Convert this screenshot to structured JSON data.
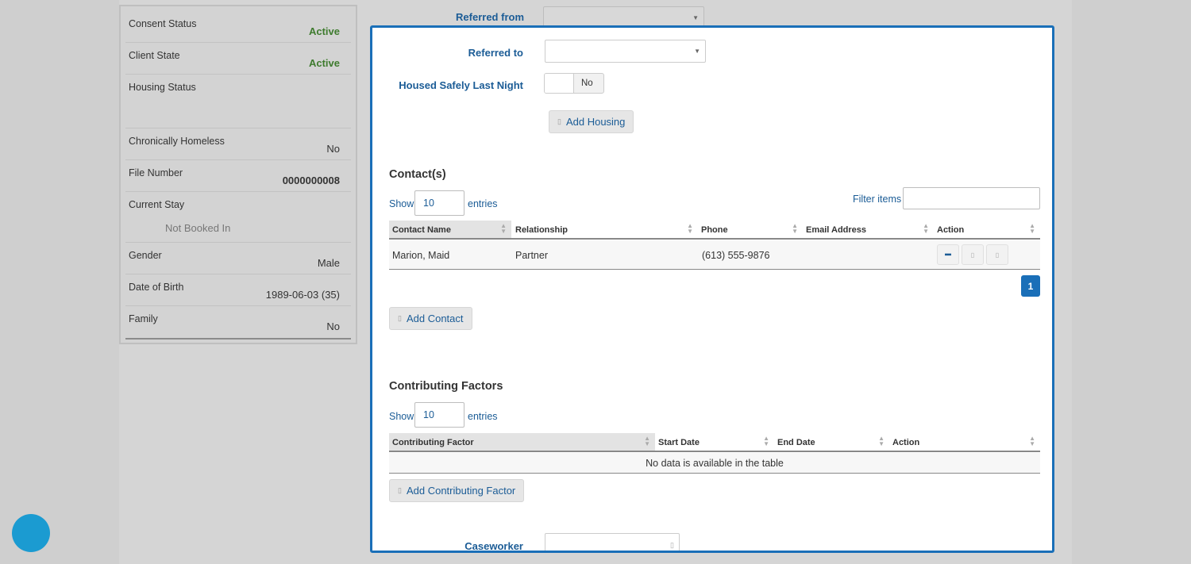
{
  "client_info": [
    {
      "label": "Consent Status",
      "value": "Active"
    },
    {
      "label": "Client State",
      "value": "Active"
    },
    {
      "label": "Housing Status",
      "value": ""
    },
    {
      "label": "Chronically Homeless",
      "value": "No"
    },
    {
      "label": "File Number",
      "value": "0000000008"
    },
    {
      "label": "Current Stay",
      "value": "Not Booked In"
    },
    {
      "label": "Gender",
      "value": "Male"
    },
    {
      "label": "Date of Birth",
      "value": "1989-06-03 (35)"
    },
    {
      "label": "Family",
      "value": "No"
    }
  ],
  "form": {
    "referred_from_label": "Referred from",
    "referred_to_label": "Referred to",
    "housed_safely_label": "Housed Safely Last Night",
    "housed_safely_value": "No",
    "add_housing_label": "Add Housing",
    "caseworker_label": "Caseworker"
  },
  "contacts": {
    "title": "Contact(s)",
    "show_label": "Show",
    "entries_value": "10",
    "entries_label": "entries",
    "filter_label": "Filter items",
    "columns": [
      "Contact Name",
      "Relationship",
      "Phone",
      "Email Address",
      "Action"
    ],
    "rows": [
      {
        "name": "Marion, Maid",
        "relationship": "Partner",
        "phone": "(613) 555-9876",
        "email": ""
      }
    ],
    "page": "1",
    "add_label": "Add Contact"
  },
  "factors": {
    "title": "Contributing Factors",
    "show_label": "Show",
    "entries_value": "10",
    "entries_label": "entries",
    "columns": [
      "Contributing Factor",
      "Start Date",
      "End Date",
      "Action"
    ],
    "empty_text": "No data is available in the table",
    "add_label": "Add Contributing Factor"
  },
  "colors": {
    "accent": "#1a6fb8",
    "active_green": "#3e7b2e",
    "fab": "#1b9bd1"
  }
}
